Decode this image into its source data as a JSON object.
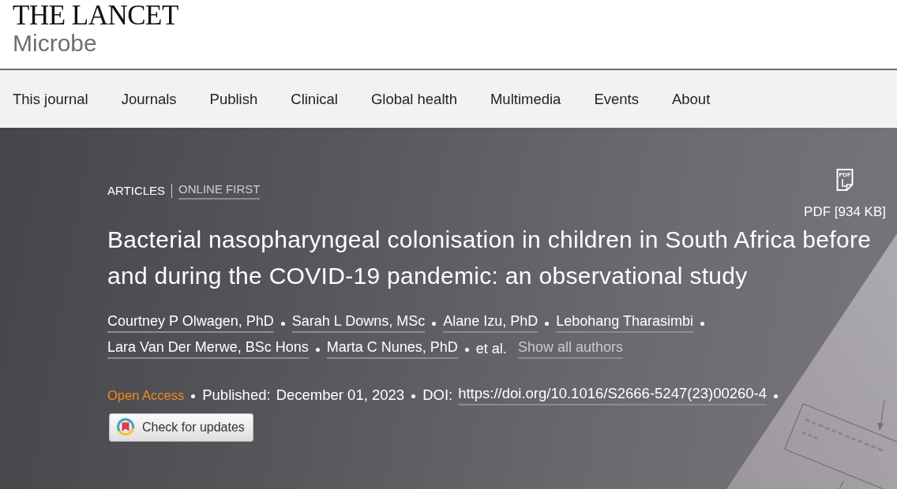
{
  "header": {
    "journal_name": "THE LANCET",
    "journal_subtitle": "Microbe"
  },
  "nav": [
    "This journal",
    "Journals",
    "Publish",
    "Clinical",
    "Global health",
    "Multimedia",
    "Events",
    "About"
  ],
  "article": {
    "section": "ARTICLES",
    "subsection": "ONLINE FIRST",
    "pdf": {
      "icon_label": "PDF",
      "label": "PDF [934 KB]"
    },
    "title": "Bacterial nasopharyngeal colonisation in children in South Africa before and during the COVID-19 pandemic: an observational study",
    "authors": [
      "Courtney P Olwagen, PhD",
      "Sarah L Downs, MSc",
      "Alane Izu, PhD",
      "Lebohang Tharasimbi",
      "Lara Van Der Merwe, BSc Hons",
      "Marta C Nunes, PhD"
    ],
    "et_al": "et al.",
    "show_all_authors": "Show all authors",
    "access": "Open Access",
    "published": {
      "label": "Published:",
      "date": "December 01, 2023"
    },
    "doi": {
      "label": "DOI:",
      "link": "https://doi.org/10.1016/S2666-5247(23)00260-4"
    },
    "check_updates_button": "Check for updates"
  }
}
